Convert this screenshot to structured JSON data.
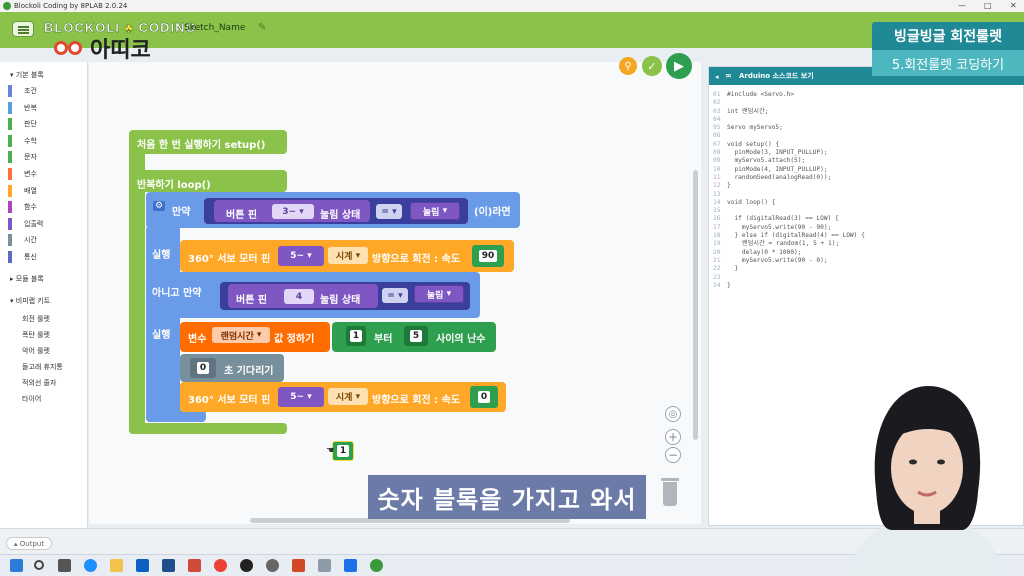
{
  "window": {
    "title": "Blockoli Coding by 8PLAB 2.0.24",
    "controls": [
      "—",
      "□",
      "✕"
    ]
  },
  "header": {
    "brand_left": "BLOCKOLI",
    "brand_right": "CODING",
    "separator": ":",
    "sketch_name": "Sketch_Name",
    "menu_icon": "list-menu-icon",
    "edit_icon": "pencil-icon"
  },
  "logo": {
    "text": "아띠코"
  },
  "badge": {
    "title": "빙글빙글 회전룰렛",
    "subtitle": "5.회전룰렛 코딩하기"
  },
  "palette": {
    "group1": "기본 블록",
    "categories": [
      {
        "label": "조건",
        "color": "#6a85d8"
      },
      {
        "label": "반복",
        "color": "#5aa0e0"
      },
      {
        "label": "판단",
        "color": "#4caf50"
      },
      {
        "label": "수학",
        "color": "#4caf50"
      },
      {
        "label": "문자",
        "color": "#4caf50"
      },
      {
        "label": "변수",
        "color": "#ff7043"
      },
      {
        "label": "배열",
        "color": "#ffa726"
      },
      {
        "label": "함수",
        "color": "#ab47bc"
      },
      {
        "label": "입출력",
        "color": "#7e57c2"
      },
      {
        "label": "시간",
        "color": "#78909c"
      },
      {
        "label": "통신",
        "color": "#5c6bc0"
      }
    ],
    "group2": "모듈 블록",
    "group3": "비피랩 키트",
    "kit_items": [
      "회전 룰렛",
      "폭탄 룰렛",
      "악어 룰렛",
      "돌고래 휴지통",
      "적외선 줄자",
      "타이어"
    ]
  },
  "workspace": {
    "setup_label": "처음 한 번 실행하기 setup()",
    "loop_label": "반복하기 loop()",
    "if_label": "만약",
    "then_suffix": "(이)라면",
    "button_pin_label": "버튼 핀",
    "pin_a": "3~",
    "pin_b": "4",
    "pressed_state": "눌림 상태",
    "equals": "=",
    "pressed_value": "눌림",
    "do_label": "실행",
    "elseif_label": "아니고 만약",
    "servo_label": "360° 서보 모터 핀",
    "servo_pin": "5~",
    "direction": "시계",
    "rotate_label": "방향으로 회전 : 속도",
    "speed_1": "90",
    "speed_2": "0",
    "var_label": "변수",
    "var_name": "랜덤시간",
    "set_label": "값 정하기",
    "rand_from": "1",
    "rand_mid": "부터",
    "rand_to": "5",
    "rand_label": "사이의 난수",
    "wait_value": "0",
    "wait_label": "초 기다리기",
    "floating_number": "1"
  },
  "code_panel": {
    "title": "Arduino 소스코드 보기",
    "lines": [
      {
        "n": "01",
        "t": "#include <Servo.h>"
      },
      {
        "n": "02",
        "t": ""
      },
      {
        "n": "03",
        "t": "int 랜덤시간;"
      },
      {
        "n": "04",
        "t": ""
      },
      {
        "n": "05",
        "t": "Servo myServo5;"
      },
      {
        "n": "06",
        "t": ""
      },
      {
        "n": "07",
        "t": "void setup() {"
      },
      {
        "n": "08",
        "t": "  pinMode(3, INPUT_PULLUP);"
      },
      {
        "n": "09",
        "t": "  myServo5.attach(5);"
      },
      {
        "n": "10",
        "t": "  pinMode(4, INPUT_PULLUP);"
      },
      {
        "n": "11",
        "t": "  randomSeed(analogRead(0));"
      },
      {
        "n": "12",
        "t": "}"
      },
      {
        "n": "13",
        "t": ""
      },
      {
        "n": "14",
        "t": "void loop() {"
      },
      {
        "n": "15",
        "t": ""
      },
      {
        "n": "16",
        "t": "  if (digitalRead(3) == LOW) {"
      },
      {
        "n": "17",
        "t": "    myServo5.write(90 - 90);"
      },
      {
        "n": "18",
        "t": "  } else if (digitalRead(4) == LOW) {"
      },
      {
        "n": "19",
        "t": "    랜덤시간 = random(1, 5 + 1);"
      },
      {
        "n": "20",
        "t": "    delay(0 * 1000);"
      },
      {
        "n": "21",
        "t": "    myServo5.write(90 - 0);"
      },
      {
        "n": "22",
        "t": "  }"
      },
      {
        "n": "23",
        "t": ""
      },
      {
        "n": "24",
        "t": "}"
      }
    ]
  },
  "caption": "숫자 블록을 가지고 와서",
  "output": {
    "label": "Output"
  },
  "colors": {
    "header": "#8bc34a",
    "control": "#6a9be8",
    "servo": "#ffa726",
    "variable": "#ff6d00",
    "math": "#2e9e4f",
    "io": "#7e57c2",
    "time": "#78909c",
    "loop": "#8bc34a",
    "accent": "#1f8a96"
  }
}
